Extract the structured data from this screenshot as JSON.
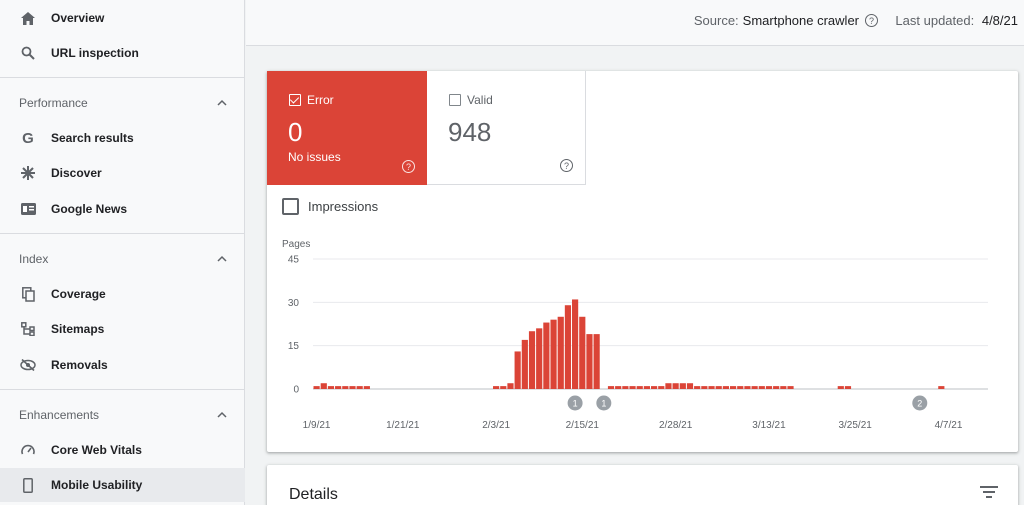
{
  "sidebar": {
    "overview": "Overview",
    "url_inspection": "URL inspection",
    "performance": {
      "header": "Performance",
      "items": [
        "Search results",
        "Discover",
        "Google News"
      ]
    },
    "index": {
      "header": "Index",
      "items": [
        "Coverage",
        "Sitemaps",
        "Removals"
      ]
    },
    "enhancements": {
      "header": "Enhancements",
      "items": [
        "Core Web Vitals",
        "Mobile Usability"
      ]
    }
  },
  "header": {
    "source_label": "Source:",
    "source_value": "Smartphone crawler",
    "updated_label": "Last updated:",
    "updated_value": "4/8/21"
  },
  "tiles": {
    "error": {
      "label": "Error",
      "value": "0",
      "sub": "No issues",
      "checked": true,
      "color": "#db4437"
    },
    "valid": {
      "label": "Valid",
      "value": "948",
      "checked": false
    }
  },
  "impressions_label": "Impressions",
  "chart_data": {
    "type": "bar",
    "ylabel": "Pages",
    "yticks": [
      45,
      30,
      15,
      0
    ],
    "ylim": [
      0,
      45
    ],
    "x_tick_labels": [
      "1/9/21",
      "1/21/21",
      "2/3/21",
      "2/15/21",
      "2/28/21",
      "3/13/21",
      "3/25/21",
      "4/7/21"
    ],
    "x_tick_day_index": [
      0,
      12,
      25,
      37,
      50,
      63,
      75,
      88
    ],
    "values": [
      1,
      2,
      1,
      1,
      1,
      1,
      1,
      1,
      0,
      0,
      0,
      0,
      0,
      0,
      0,
      0,
      0,
      0,
      0,
      0,
      0,
      0,
      0,
      0,
      0,
      1,
      1,
      2,
      13,
      17,
      20,
      21,
      23,
      24,
      25,
      29,
      31,
      25,
      19,
      19,
      0,
      1,
      1,
      1,
      1,
      1,
      1,
      1,
      1,
      2,
      2,
      2,
      2,
      1,
      1,
      1,
      1,
      1,
      1,
      1,
      1,
      1,
      1,
      1,
      1,
      1,
      1,
      0,
      0,
      0,
      0,
      0,
      0,
      1,
      1,
      0,
      0,
      0,
      0,
      0,
      0,
      0,
      0,
      0,
      0,
      0,
      0,
      1,
      0,
      0,
      0,
      0,
      0,
      0
    ],
    "bar_color": "#db4437",
    "annotations": [
      {
        "day_index": 36,
        "label": "1"
      },
      {
        "day_index": 40,
        "label": "1"
      },
      {
        "day_index": 84,
        "label": "2"
      }
    ],
    "grid": true
  },
  "details": {
    "title": "Details"
  }
}
